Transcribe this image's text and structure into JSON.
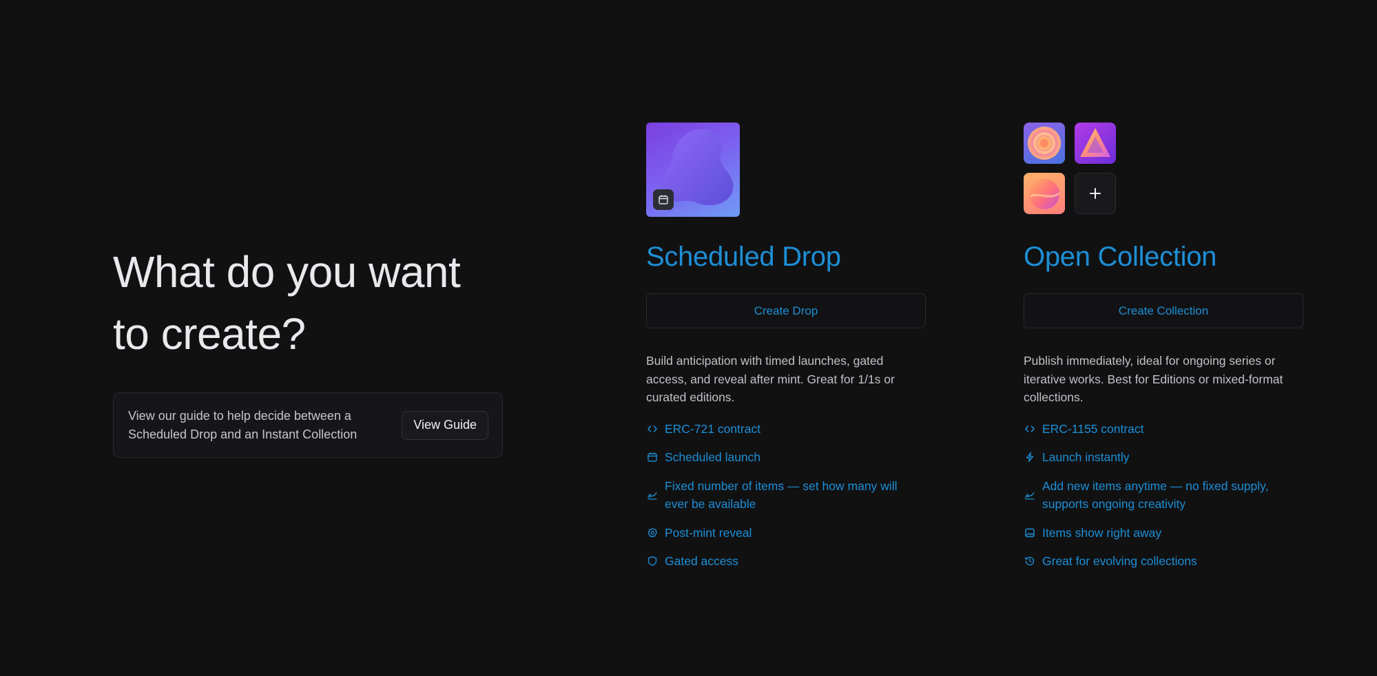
{
  "intro": {
    "title_line1": "What do you want",
    "title_line2": "to create?",
    "guide_text": "View our guide to help decide between a Scheduled Drop and an Instant Collection",
    "guide_button": "View Guide"
  },
  "options": {
    "drop": {
      "title": "Scheduled Drop",
      "button": "Create Drop",
      "description": "Build anticipation with timed launches, gated access, and reveal after mint. Great for 1/1s or curated editions.",
      "features": [
        {
          "icon": "code-icon",
          "text": "ERC-721 contract"
        },
        {
          "icon": "calendar-icon",
          "text": "Scheduled launch"
        },
        {
          "icon": "signature-icon",
          "text": "Fixed number of items — set how many will ever be available"
        },
        {
          "icon": "reveal-icon",
          "text": "Post-mint reveal"
        },
        {
          "icon": "shield-icon",
          "text": "Gated access"
        }
      ]
    },
    "open": {
      "title": "Open Collection",
      "button": "Create Collection",
      "description": "Publish immediately, ideal for ongoing series or iterative works. Best for Editions or mixed-format collections.",
      "features": [
        {
          "icon": "code-icon",
          "text": "ERC-1155 contract"
        },
        {
          "icon": "lightning-icon",
          "text": "Launch instantly"
        },
        {
          "icon": "signature-icon",
          "text": "Add new items anytime — no fixed supply, supports ongoing creativity"
        },
        {
          "icon": "image-icon",
          "text": "Items show right away"
        },
        {
          "icon": "history-icon",
          "text": "Great for evolving collections"
        }
      ]
    }
  },
  "colors": {
    "background": "#111112",
    "accent": "#1d8fd6",
    "heading": "#e9e9ec",
    "body_text": "#c2c2c7"
  }
}
